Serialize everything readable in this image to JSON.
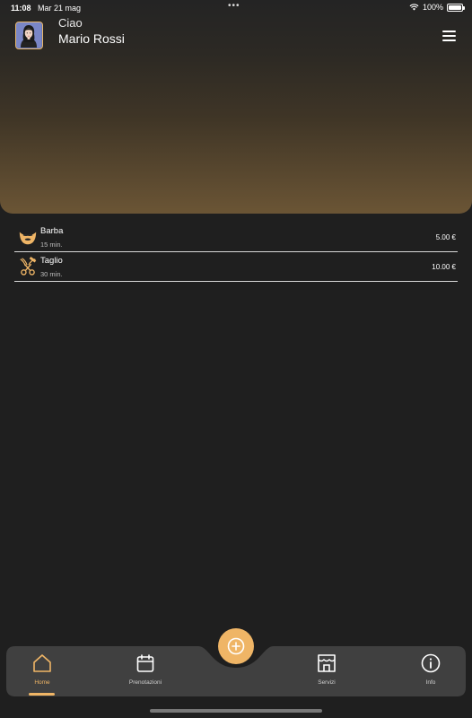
{
  "status_bar": {
    "time": "11:08",
    "date": "Mar 21 mag",
    "battery": "100%",
    "battery_level": 1.0
  },
  "header": {
    "greeting": "Ciao",
    "user_name": "Mario Rossi"
  },
  "services": [
    {
      "name": "Barba",
      "duration": "15 min.",
      "price": "5.00 €",
      "icon": "beard-icon"
    },
    {
      "name": "Taglio",
      "duration": "30 min.",
      "price": "10.00 €",
      "icon": "scissors-icon"
    }
  ],
  "tabs": [
    {
      "label": "Home",
      "icon": "home-icon",
      "active": true
    },
    {
      "label": "Prenotazioni",
      "icon": "calendar-icon",
      "active": false
    },
    {
      "label": "Servizi",
      "icon": "shop-icon",
      "active": false
    },
    {
      "label": "Info",
      "icon": "info-icon",
      "active": false
    }
  ],
  "fab": {
    "icon": "plus-circle-icon"
  },
  "colors": {
    "accent": "#efb566",
    "background": "#1f1f1f",
    "tabbar": "#404040",
    "header_gradient_end": "#6b5535"
  }
}
